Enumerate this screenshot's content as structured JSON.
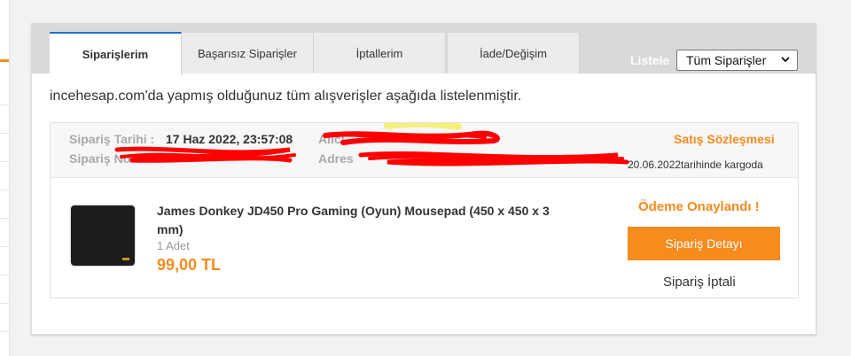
{
  "tabs": [
    {
      "label": "Siparişlerim",
      "active": true
    },
    {
      "label": "Başarısız Siparişler",
      "active": false
    },
    {
      "label": "İptallerim",
      "active": false
    },
    {
      "label": "İade/Değişim",
      "active": false
    }
  ],
  "filter": {
    "label": "Listele",
    "selected": "Tüm Siparişler"
  },
  "intro_text": "incehesap.com'da yapmış olduğunuz tüm alışverişler aşağıda listelenmiştir.",
  "order": {
    "date_label": "Sipariş Tarihi :",
    "date_value": "17 Haz 2022, 23:57:08",
    "number_label": "Sipariş No",
    "buyer_label": "Alıcı",
    "address_label": "Adres",
    "contract_link": "Satış Sözleşmesi",
    "shipping_note": "20.06.2022tarihinde kargoda",
    "product": {
      "name": "James Donkey JD450 Pro Gaming (Oyun) Mousepad (450 x 450 x 3 mm)",
      "quantity": "1 Adet",
      "price": "99,00 TL"
    },
    "status": "Ödeme Onaylandı !",
    "detail_button": "Sipariş Detayı",
    "cancel_link": "Sipariş İptali"
  },
  "colors": {
    "accent": "#f68b1e",
    "tab_active_border": "#1d74c8",
    "redaction": "#ff0000",
    "highlight": "#f5f07a"
  }
}
